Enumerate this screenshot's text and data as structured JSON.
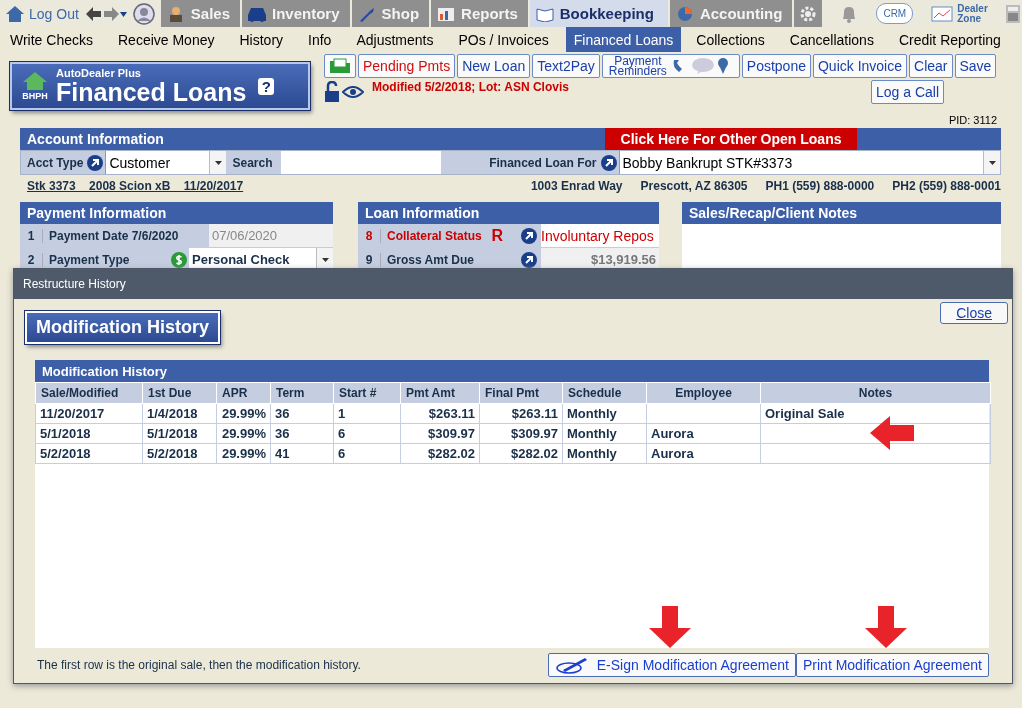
{
  "top_nav": {
    "logout": "Log Out",
    "tabs": [
      {
        "label": "Sales",
        "selected": false
      },
      {
        "label": "Inventory",
        "selected": false
      },
      {
        "label": "Shop",
        "selected": false
      },
      {
        "label": "Reports",
        "selected": false
      },
      {
        "label": "Bookkeeping",
        "selected": true
      },
      {
        "label": "Accounting",
        "selected": false
      }
    ],
    "crm": "CRM",
    "dealer_zone": "Dealer Zone"
  },
  "sub_nav": [
    {
      "label": "Write Checks",
      "selected": false
    },
    {
      "label": "Receive Money",
      "selected": false
    },
    {
      "label": "History",
      "selected": false
    },
    {
      "label": "Info",
      "selected": false
    },
    {
      "label": "Adjustments",
      "selected": false
    },
    {
      "label": "POs / Invoices",
      "selected": false
    },
    {
      "label": "Financed Loans",
      "selected": true
    },
    {
      "label": "Collections",
      "selected": false
    },
    {
      "label": "Cancellations",
      "selected": false
    },
    {
      "label": "Credit Reporting",
      "selected": false
    }
  ],
  "header": {
    "logo": "BHPH",
    "brand": "AutoDealer Plus",
    "title": "Financed Loans",
    "help": "?",
    "status": "Modified 5/2/2018; Lot: ASN Clovis",
    "pid": "PID: 3112"
  },
  "toolbar": [
    {
      "label": "Pending Pmts",
      "alert": true
    },
    {
      "label": "New Loan",
      "alert": false
    },
    {
      "label": "Text2Pay",
      "alert": false
    },
    {
      "label": "Payment Reminders",
      "alert": false,
      "kind": "reminders"
    },
    {
      "label": "Postpone",
      "alert": false
    },
    {
      "label": "Quick Invoice",
      "alert": false
    },
    {
      "label": "Clear",
      "alert": false
    },
    {
      "label": "Save",
      "alert": false
    }
  ],
  "log_call": "Log a Call",
  "account": {
    "title": "Account Information",
    "other_loans": "Click Here For Other Open Loans",
    "acct_type_label": "Acct Type",
    "acct_type": "Customer",
    "search_label": "Search",
    "financed_for_label": "Financed Loan For",
    "financed_for": "Bobby Bankrupt STK#3373",
    "vehicle": [
      "Stk 3373",
      "2008 Scion xB",
      "11/20/2017"
    ],
    "contact": [
      "1003 Enrad Way",
      "Prescott, AZ 86305",
      "PH1 (559) 888-0000",
      "PH2 (559) 888-0001"
    ]
  },
  "payment_info": {
    "title": "Payment Information",
    "rows": [
      {
        "num": "1",
        "label": "Payment Date  7/6/2020",
        "value": "07/06/2020",
        "disabled": true,
        "kind": "text"
      },
      {
        "num": "2",
        "label": "Payment Type",
        "value": "Personal Check",
        "disabled": false,
        "kind": "select"
      }
    ]
  },
  "loan_info": {
    "title": "Loan Information",
    "rows": [
      {
        "num": "8",
        "label": "Collateral Status",
        "flag": "R",
        "value": "Involuntary Repos",
        "alert": true
      },
      {
        "num": "9",
        "label": "Gross Amt Due",
        "value": "$13,919.56",
        "alert": false
      }
    ]
  },
  "notes_panel": {
    "title": "Sales/Recap/Client Notes"
  },
  "modal": {
    "title": "Restructure History",
    "heading": "Modification History",
    "close": "Close",
    "table_title": "Modification History",
    "columns": [
      "Sale/Modified",
      "1st Due",
      "APR",
      "Term",
      "Start #",
      "Pmt Amt",
      "Final Pmt",
      "Schedule",
      "Employee",
      "Notes"
    ],
    "rows": [
      [
        "11/20/2017",
        "1/4/2018",
        "29.99%",
        "36",
        "1",
        "$263.11",
        "$263.11",
        "Monthly",
        "",
        "Original Sale"
      ],
      [
        "5/1/2018",
        "5/1/2018",
        "29.99%",
        "36",
        "6",
        "$309.97",
        "$309.97",
        "Monthly",
        "Aurora",
        ""
      ],
      [
        "5/2/2018",
        "5/2/2018",
        "29.99%",
        "41",
        "6",
        "$282.02",
        "$282.02",
        "Monthly",
        "Aurora",
        ""
      ]
    ],
    "footer": "The first row is the original sale, then the modification history.",
    "buttons": [
      {
        "label": "E-Sign Modification Agreement",
        "kind": "esign"
      },
      {
        "label": "Print Modification Agreement",
        "kind": "print"
      }
    ]
  }
}
